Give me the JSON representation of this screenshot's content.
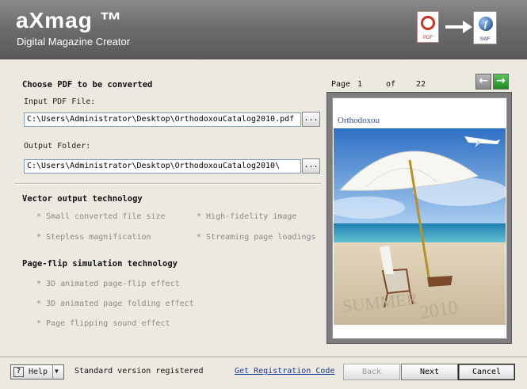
{
  "header": {
    "brand": "aXmag ™",
    "tagline": "Digital Magazine Creator",
    "pdf_icon_label": "PDF",
    "swf_icon_label": "SWF",
    "swf_icon_glyph": "f",
    "icons": [
      "pdf-icon",
      "arrow-right-icon",
      "swf-icon"
    ]
  },
  "form": {
    "choose_title": "Choose PDF to be converted",
    "input_label": "Input PDF File:",
    "input_value": "C:\\Users\\Administrator\\Desktop\\OrthodoxouCatalog2010.pdf",
    "output_label": "Output Folder:",
    "output_value": "C:\\Users\\Administrator\\Desktop\\OrthodoxouCatalog2010\\",
    "browse_label": "..."
  },
  "vector": {
    "title": "Vector output technology",
    "features": [
      "* Small converted file size",
      "* High-fidelity image",
      "* Stepless magnification",
      "* Streaming page loadings"
    ]
  },
  "pageflip": {
    "title": "Page-flip simulation technology",
    "features": [
      "* 3D animated page-flip effect",
      "* 3D animated page folding effect",
      "* Page flipping sound effect"
    ]
  },
  "preview": {
    "page_label": "Page",
    "current_page": "1",
    "of_label": "of",
    "total_pages": "22",
    "prev_glyph": "←",
    "next_glyph": "→",
    "brand_text": "Orthodoxou"
  },
  "footer": {
    "help_label": "Help",
    "help_glyph": "?",
    "help_arrow": "▼",
    "status": "Standard version registered",
    "registration_link": "Get Registration Code",
    "back_label": "Back",
    "next_label": "Next",
    "cancel_label": "Cancel"
  },
  "colors": {
    "header_bg": "#6d6d6d",
    "next_arrow": "#1d8a1d",
    "link": "#1a3a9a"
  }
}
